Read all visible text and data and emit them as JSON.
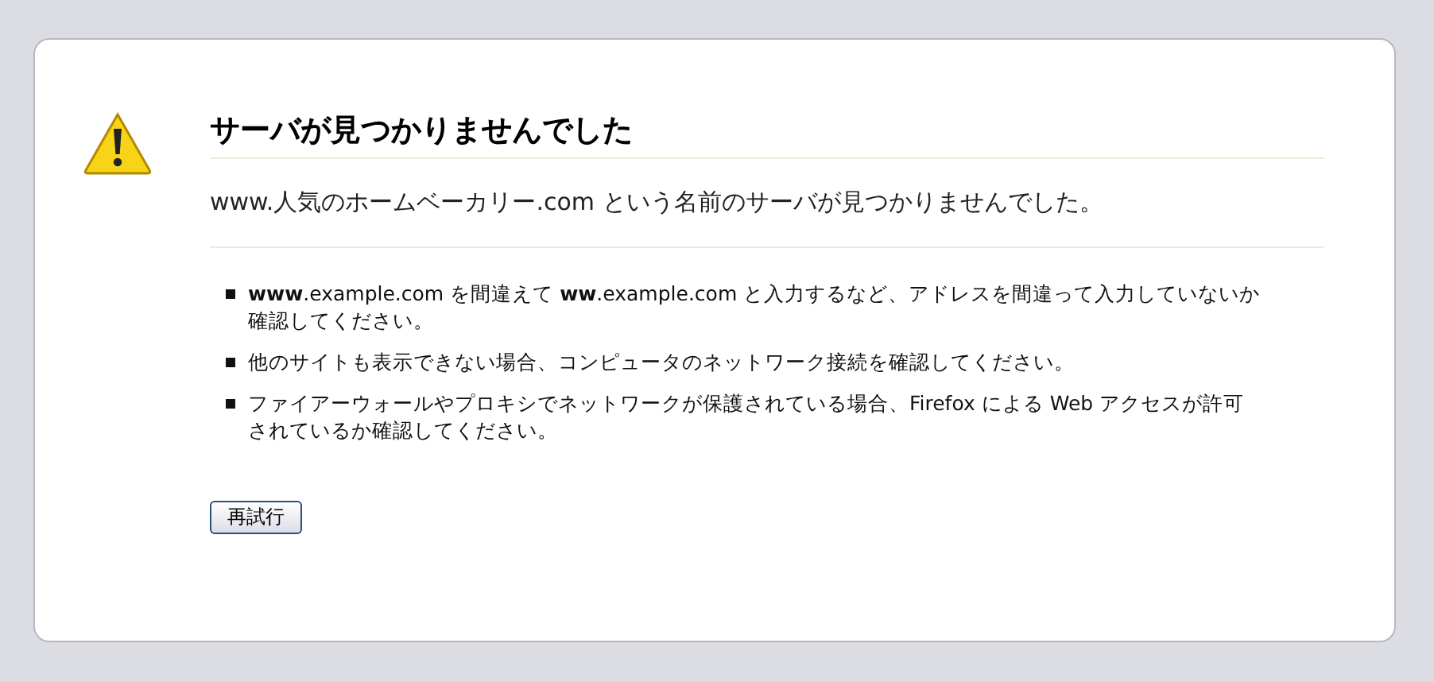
{
  "title": "サーバが見つかりませんでした",
  "message": "www.人気のホームベーカリー.com という名前のサーバが見つかりませんでした。",
  "suggestions": [
    "**www**.example.com を間違えて **ww**.example.com と入力するなど、アドレスを間違って入力していないか確認してください。",
    "他のサイトも表示できない場合、コンピュータのネットワーク接続を確認してください。",
    "ファイアーウォールやプロキシでネットワークが保護されている場合、Firefox による Web アクセスが許可されているか確認してください。"
  ],
  "button": "再試行"
}
